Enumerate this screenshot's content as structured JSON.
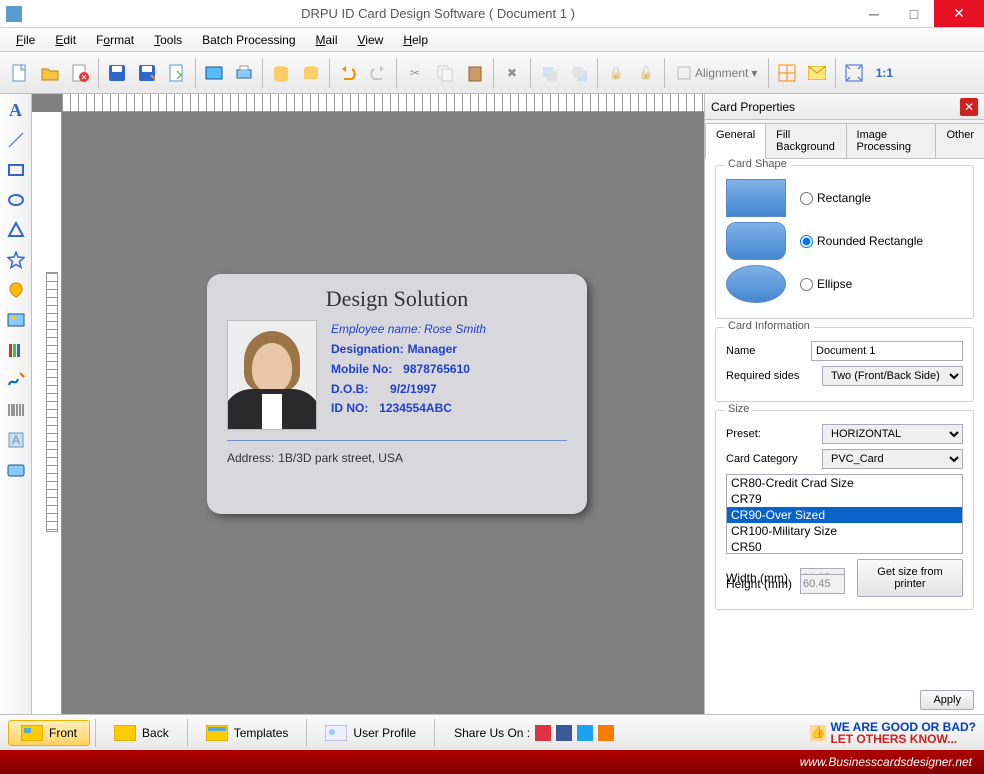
{
  "titlebar": {
    "text": "DRPU ID Card Design Software ( Document 1 )"
  },
  "menu": {
    "file": "File",
    "edit": "Edit",
    "format": "Format",
    "tools": "Tools",
    "batch": "Batch Processing",
    "mail": "Mail",
    "view": "View",
    "help": "Help"
  },
  "toolbar": {
    "alignment": "Alignment"
  },
  "card": {
    "title": "Design Solution",
    "emp_label": "Employee name:",
    "emp_value": "Rose Smith",
    "des_label": "Designation:",
    "des_value": "Manager",
    "mobile_label": "Mobile No:",
    "mobile_value": "9878765610",
    "dob_label": "D.O.B:",
    "dob_value": "9/2/1997",
    "id_label": "ID NO:",
    "id_value": "1234554ABC",
    "addr_label": "Address:",
    "addr_value": "1B/3D park street, USA"
  },
  "props": {
    "title": "Card Properties",
    "tabs": {
      "general": "General",
      "fill": "Fill Background",
      "image": "Image Processing",
      "other": "Other"
    },
    "shape": {
      "legend": "Card Shape",
      "rect": "Rectangle",
      "rrect": "Rounded Rectangle",
      "ellipse": "Ellipse"
    },
    "info": {
      "legend": "Card Information",
      "name_lbl": "Name",
      "name_val": "Document 1",
      "sides_lbl": "Required sides",
      "sides_val": "Two (Front/Back Side)"
    },
    "size": {
      "legend": "Size",
      "preset_lbl": "Preset:",
      "preset_val": "HORIZONTAL",
      "cat_lbl": "Card Category",
      "cat_val": "PVC_Card",
      "items": [
        "CR80-Credit Crad Size",
        "CR79",
        "CR90-Over Sized",
        "CR100-Military Size",
        "CR50"
      ],
      "width_lbl": "Width  (mm)",
      "width_val": "91.95",
      "height_lbl": "Height (mm)",
      "height_val": "60.45",
      "printer_btn": "Get size from printer"
    },
    "apply": "Apply"
  },
  "bottom": {
    "front": "Front",
    "back": "Back",
    "templates": "Templates",
    "profile": "User Profile",
    "share": "Share Us On :",
    "promo1": "WE ARE GOOD OR BAD?",
    "promo2": "LET OTHERS KNOW..."
  },
  "footer": "www.Businesscardsdesigner.net"
}
